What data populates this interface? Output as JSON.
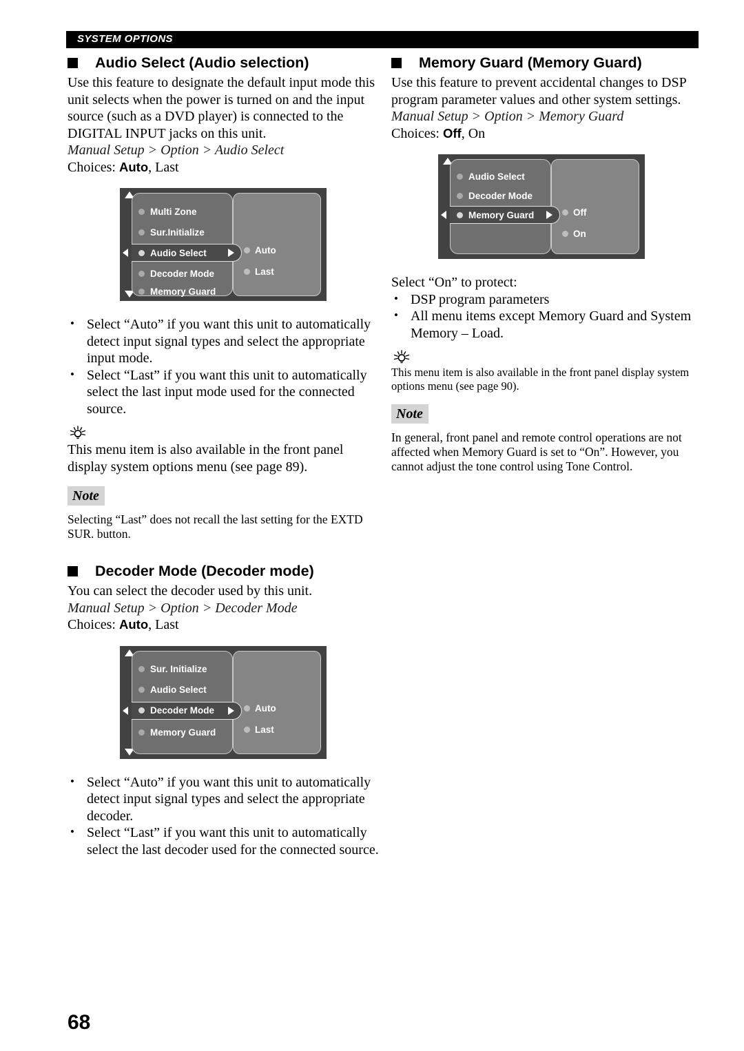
{
  "header": {
    "running_head": "SYSTEM OPTIONS"
  },
  "page": {
    "number": "68"
  },
  "left_column": {
    "section1": {
      "title": "Audio Select (Audio selection)",
      "intro": "Use this feature to designate the default input mode this unit selects when the power is turned on and the input source (such as a DVD player) is connected to the DIGITAL INPUT jacks on this unit.",
      "path": "Manual Setup > Option > Audio Select",
      "choices_label": "Choices:",
      "choices_default": "Auto",
      "choices_rest": ", Last",
      "osd": {
        "items": [
          "Multi Zone",
          "Sur.Initialize",
          "Audio Select",
          "Decoder Mode",
          "Memory Guard"
        ],
        "selected": "Audio Select",
        "options": [
          "Auto",
          "Last"
        ],
        "scroll_up": true,
        "scroll_down": true
      },
      "bullets": [
        "Select “Auto” if you want this unit to automatically detect input signal types and select the appropriate input mode.",
        "Select “Last” if you want this unit to automatically select the last input mode used for the connected source."
      ],
      "tip": "This menu item is also available in the front panel display system options menu (see page 89).",
      "note_label": "Note",
      "note": "Selecting “Last” does not recall the last setting for the EXTD SUR. button."
    },
    "section2": {
      "title": "Decoder Mode (Decoder mode)",
      "intro": "You can select the decoder used by this unit.",
      "path": "Manual Setup > Option > Decoder Mode",
      "choices_label": "Choices:",
      "choices_default": "Auto",
      "choices_rest": ", Last",
      "osd": {
        "items": [
          "Sur. Initialize",
          "Audio Select",
          "Decoder Mode",
          "Memory Guard"
        ],
        "selected": "Decoder Mode",
        "options": [
          "Auto",
          "Last"
        ],
        "scroll_up": true,
        "scroll_down": true
      },
      "bullets": [
        "Select “Auto” if you want this unit to automatically detect input signal types and select the appropriate decoder.",
        "Select “Last” if you want this unit to automatically select the last decoder used for the connected source."
      ]
    }
  },
  "right_column": {
    "section1": {
      "title": "Memory Guard (Memory Guard)",
      "intro": "Use this feature to prevent accidental changes to DSP program parameter values and other system settings.",
      "path": "Manual Setup > Option > Memory Guard",
      "choices_label": "Choices:",
      "choices_default": "Off",
      "choices_rest": ", On",
      "osd": {
        "items": [
          "Audio Select",
          "Decoder Mode",
          "Memory Guard"
        ],
        "selected": "Memory Guard",
        "options": [
          "Off",
          "On"
        ],
        "scroll_up": true,
        "scroll_down": false
      },
      "protect_lead": "Select “On” to protect:",
      "bullets": [
        "DSP program parameters",
        "All menu items except Memory Guard and System Memory – Load."
      ],
      "tip": "This menu item is also available in the front panel display system options menu (see page 90).",
      "note_label": "Note",
      "note": "In general, front panel and remote control operations are not affected when Memory Guard is set to “On”. However, you cannot adjust the tone control using Tone Control."
    }
  }
}
